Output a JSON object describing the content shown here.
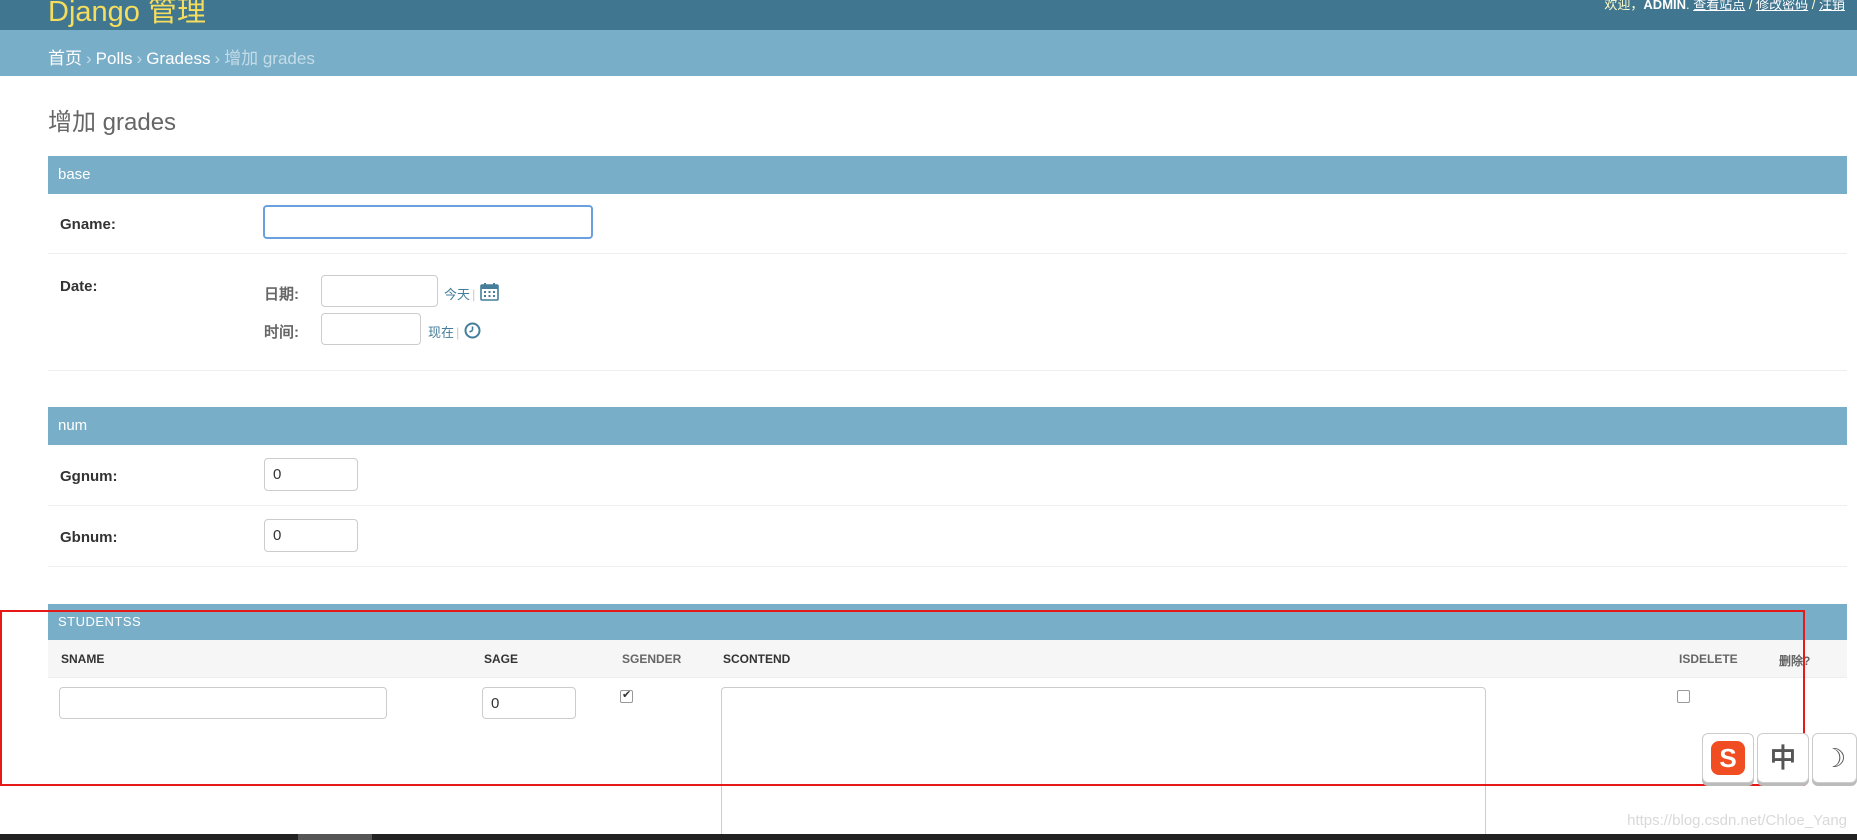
{
  "header": {
    "brand": "Django 管理",
    "welcome": "欢迎，",
    "username": "ADMIN",
    "links": [
      "查看站点",
      "修改密码",
      "注销"
    ],
    "link_sep": " / "
  },
  "breadcrumbs": {
    "items": [
      "首页",
      "Polls",
      "Gradess"
    ],
    "current": "增加 grades",
    "sep": "›"
  },
  "page_title": "增加 grades",
  "fieldsets": {
    "base": {
      "caption": "base",
      "gname_label": "Gname:",
      "gname_value": "",
      "date_label": "Date:",
      "date_sublabel": "日期:",
      "date_value": "",
      "today_link": "今天",
      "time_sublabel": "时间:",
      "time_value": "",
      "now_link": "现在",
      "link_sep": "|"
    },
    "num": {
      "caption": "num",
      "ggnum_label": "Ggnum:",
      "ggnum_value": "0",
      "gbnum_label": "Gbnum:",
      "gbnum_value": "0"
    }
  },
  "inline": {
    "caption": "STUDENTSS",
    "headers": {
      "sname": "SNAME",
      "sage": "SAGE",
      "sgender": "SGENDER",
      "scontend": "SCONTEND",
      "isdelete": "ISDELETE",
      "delete": "删除?"
    },
    "row": {
      "sname": "",
      "sage": "0",
      "sgender_checked": true,
      "scontend": "",
      "isdelete_checked": false
    }
  },
  "ime": {
    "sogou": "S",
    "chinese": "中",
    "moon": "☽"
  },
  "watermark": "https://blog.csdn.net/Chloe_Yang",
  "colors": {
    "header_bg": "#417690",
    "brand": "#f5dd5d",
    "breadcrumb_bg": "#79aec8",
    "caption_bg": "#79aec8",
    "link": "#447e9b",
    "annotation": "#e61919"
  }
}
